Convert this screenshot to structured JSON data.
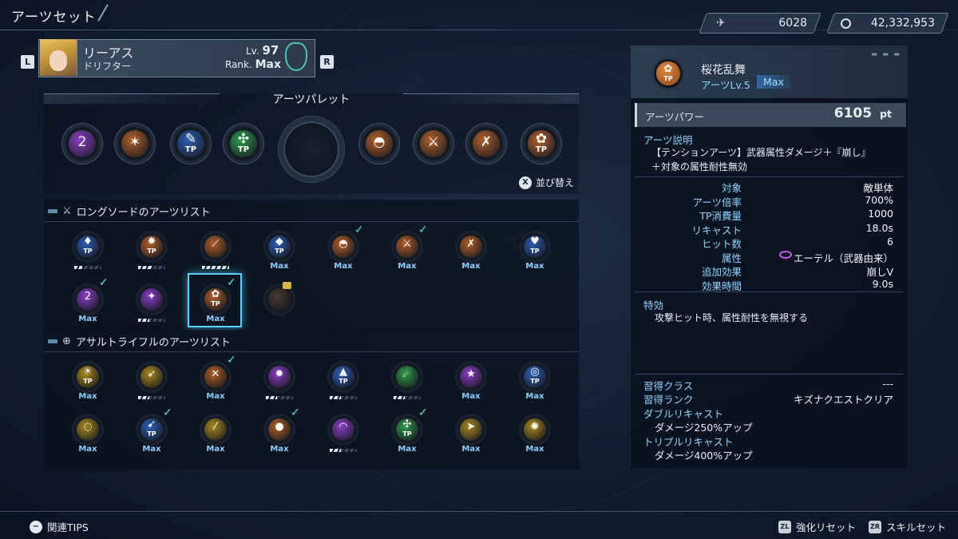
{
  "header": {
    "title": "アーツセット",
    "currency1": "6028",
    "currency2": "42,332,953"
  },
  "character": {
    "name": "リーアス",
    "class": "ドリフター",
    "level_label": "Lv.",
    "level": "97",
    "rank_label": "Rank.",
    "rank": "Max",
    "prev_btn": "L",
    "next_btn": "R"
  },
  "palette": {
    "title": "アーツパレット",
    "sort_button": "X",
    "sort_label": "並び替え",
    "slots": [
      {
        "icon": "purple-swirl-icon",
        "color": "#8a3fc4",
        "glyph": "2",
        "tp": ""
      },
      {
        "icon": "bronze-burst-icon",
        "color": "#b0602a",
        "glyph": "✶",
        "tp": ""
      },
      {
        "icon": "blue-tp-icon",
        "color": "#2c5fb4",
        "glyph": "✎",
        "tp": "TP"
      },
      {
        "icon": "green-tp-icon",
        "color": "#2f9a4a",
        "glyph": "✣",
        "tp": "TP"
      },
      {
        "icon": "bronze-dome-icon",
        "color": "#b0602a",
        "glyph": "◓",
        "tp": ""
      },
      {
        "icon": "bronze-slash-icon",
        "color": "#b0602a",
        "glyph": "⚔",
        "tp": ""
      },
      {
        "icon": "bronze-cross-icon",
        "color": "#b0602a",
        "glyph": "✗",
        "tp": ""
      },
      {
        "icon": "bronze-tp-icon",
        "color": "#b0602a",
        "glyph": "✿",
        "tp": "TP"
      }
    ]
  },
  "longsword": {
    "title": "ロングソードのアーツリスト",
    "items": [
      {
        "icon": "blue-flame-tp-icon",
        "color": "#2c5fb4",
        "glyph": "♦",
        "tp": "TP",
        "cap": "",
        "level": 0.3,
        "check": false
      },
      {
        "icon": "bronze-star-tp-icon",
        "color": "#b0602a",
        "glyph": "✸",
        "tp": "TP",
        "cap": "",
        "level": 0.5,
        "check": false
      },
      {
        "icon": "bronze-blade-icon",
        "color": "#b0602a",
        "glyph": "⟋",
        "tp": "",
        "cap": "",
        "level": 1.0,
        "check": false
      },
      {
        "icon": "blue-gem-tp-icon",
        "color": "#2c5fb4",
        "glyph": "◆",
        "tp": "TP",
        "cap": "Max",
        "level": null,
        "check": false
      },
      {
        "icon": "bronze-dome-icon",
        "color": "#b0602a",
        "glyph": "◓",
        "tp": "",
        "cap": "Max",
        "level": null,
        "check": true
      },
      {
        "icon": "bronze-slash-icon",
        "color": "#b0602a",
        "glyph": "⚔",
        "tp": "",
        "cap": "Max",
        "level": null,
        "check": true
      },
      {
        "icon": "bronze-cross-icon",
        "color": "#b0602a",
        "glyph": "✗",
        "tp": "",
        "cap": "Max",
        "level": null,
        "check": false
      },
      {
        "icon": "blue-heart-tp-icon",
        "color": "#2c5fb4",
        "glyph": "♥",
        "tp": "TP",
        "cap": "Max",
        "level": null,
        "check": false
      },
      {
        "icon": "purple-swirl-icon",
        "color": "#8a3fc4",
        "glyph": "2",
        "tp": "",
        "cap": "Max",
        "level": null,
        "check": true
      },
      {
        "icon": "purple-claw-icon",
        "color": "#8a3fc4",
        "glyph": "✦",
        "tp": "",
        "cap": "",
        "level": 0.4,
        "check": false
      },
      {
        "icon": "bronze-tp-icon",
        "color": "#b0602a",
        "glyph": "✿",
        "tp": "TP",
        "cap": "Max",
        "level": null,
        "check": true
      },
      {
        "icon": "locked-icon",
        "color": "#4a3a30",
        "glyph": "",
        "tp": "",
        "cap": "",
        "level": null,
        "check": false,
        "locked": true
      }
    ]
  },
  "assault": {
    "title": "アサルトライフルのアーツリスト",
    "items": [
      {
        "icon": "gold-sun-tp-icon",
        "color": "#a88a20",
        "glyph": "☀",
        "tp": "TP",
        "cap": "Max",
        "level": null,
        "check": false
      },
      {
        "icon": "gold-rifle-icon",
        "color": "#a88a20",
        "glyph": "➶",
        "tp": "",
        "cap": "",
        "level": 0.4,
        "check": false
      },
      {
        "icon": "bronze-rifle-icon",
        "color": "#b0602a",
        "glyph": "✕",
        "tp": "",
        "cap": "Max",
        "level": null,
        "check": true
      },
      {
        "icon": "purple-burst-icon",
        "color": "#8a3fc4",
        "glyph": "✹",
        "tp": "",
        "cap": "",
        "level": 0.4,
        "check": false
      },
      {
        "icon": "blue-wave-tp-icon",
        "color": "#2c5fb4",
        "glyph": "▲",
        "tp": "TP",
        "cap": "",
        "level": 0.4,
        "check": false
      },
      {
        "icon": "green-bolt-icon",
        "color": "#2f9a4a",
        "glyph": "☄",
        "tp": "",
        "cap": "",
        "level": 0.4,
        "check": false
      },
      {
        "icon": "purple-star-icon",
        "color": "#8a3fc4",
        "glyph": "★",
        "tp": "",
        "cap": "Max",
        "level": null,
        "check": false
      },
      {
        "icon": "blue-target-tp-icon",
        "color": "#2c5fb4",
        "glyph": "◎",
        "tp": "TP",
        "cap": "Max",
        "level": null,
        "check": false
      },
      {
        "icon": "gold-ring-icon",
        "color": "#a88a20",
        "glyph": "◌",
        "tp": "",
        "cap": "Max",
        "level": null,
        "check": false
      },
      {
        "icon": "blue-arrow-tp-icon",
        "color": "#2c5fb4",
        "glyph": "➹",
        "tp": "TP",
        "cap": "Max",
        "level": null,
        "check": true
      },
      {
        "icon": "gold-streak-icon",
        "color": "#a88a20",
        "glyph": "⁄",
        "tp": "",
        "cap": "Max",
        "level": null,
        "check": false
      },
      {
        "icon": "bronze-orb-icon",
        "color": "#b0602a",
        "glyph": "●",
        "tp": "",
        "cap": "Max",
        "level": null,
        "check": true
      },
      {
        "icon": "purple-arc-icon",
        "color": "#8a3fc4",
        "glyph": "◠",
        "tp": "",
        "cap": "",
        "level": 0.4,
        "check": false
      },
      {
        "icon": "green-tp-icon",
        "color": "#2f9a4a",
        "glyph": "✣",
        "tp": "TP",
        "cap": "Max",
        "level": null,
        "check": true
      },
      {
        "icon": "gold-shot-icon",
        "color": "#a88a20",
        "glyph": "➤",
        "tp": "",
        "cap": "Max",
        "level": null,
        "check": false
      },
      {
        "icon": "gold-spread-icon",
        "color": "#a88a20",
        "glyph": "✺",
        "tp": "",
        "cap": "Max",
        "level": null,
        "check": false
      }
    ]
  },
  "detail": {
    "name": "桜花乱舞",
    "level_label": "アーツLv.5",
    "level_badge": "Max",
    "power_label": "アーツパワー",
    "power_value": "6105",
    "power_unit": "pt",
    "desc_label": "アーツ説明",
    "desc_line1": "【テンションアーツ】武器属性ダメージ＋『崩し』",
    "desc_line2": "＋対象の属性耐性無効",
    "stats": [
      {
        "label": "対象",
        "value": "敵単体"
      },
      {
        "label": "アーツ倍率",
        "value": "700%"
      },
      {
        "label": "TP消費量",
        "value": "1000"
      },
      {
        "label": "リキャスト",
        "value": "18.0s"
      },
      {
        "label": "ヒット数",
        "value": "6"
      },
      {
        "label": "属性",
        "value": "エーテル（武器由来）"
      },
      {
        "label": "追加効果",
        "value": "崩しV"
      },
      {
        "label": "効果時間",
        "value": "9.0s"
      }
    ],
    "special_label": "特効",
    "special_text": "攻撃ヒット時、属性耐性を無視する",
    "learn_class_label": "習得クラス",
    "learn_class_value": "---",
    "learn_rank_label": "習得ランク",
    "learn_rank_value": "キズナクエストクリア",
    "double_label": "ダブルリキャスト",
    "double_text": "ダメージ250%アップ",
    "triple_label": "トリプルリキャスト",
    "triple_text": "ダメージ400%アップ"
  },
  "footer": {
    "tips_btn": "−",
    "tips_label": "関連TIPS",
    "reset_btn": "ZL",
    "reset_label": "強化リセット",
    "skill_btn": "ZR",
    "skill_label": "スキルセット"
  }
}
